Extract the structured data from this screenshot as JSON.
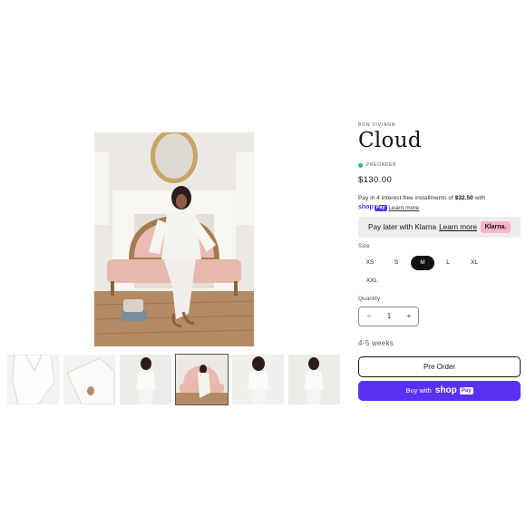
{
  "product": {
    "vendor": "BON VIVIANN",
    "title": "Cloud",
    "status": "PREORDER",
    "price": "$130.00"
  },
  "installments": {
    "prefix": "Pay in 4 interest-free installments of ",
    "amount": "$32.50",
    "suffix": " with",
    "logo_shop": "shop",
    "logo_pay": "Pay",
    "learn_more": "Learn more"
  },
  "klarna": {
    "text": "Pay later with Klarna",
    "learn_more": "Learn more",
    "badge": "Klarna."
  },
  "size": {
    "label": "Size",
    "options": [
      "XS",
      "S",
      "M",
      "L",
      "XL",
      "XXL"
    ],
    "selected": "M"
  },
  "quantity": {
    "label": "Quantity",
    "value": "1",
    "minus": "−",
    "plus": "+"
  },
  "shipping_time": "4-5 weeks",
  "buttons": {
    "pre_order": "Pre Order",
    "buy_with": "Buy with",
    "shop": "shop",
    "pay": "Pay"
  },
  "colors": {
    "shop_pay": "#5a31f4",
    "klarna_pink": "#ffb3c7",
    "status_green": "#35c45a",
    "selected_size": "#121212"
  }
}
